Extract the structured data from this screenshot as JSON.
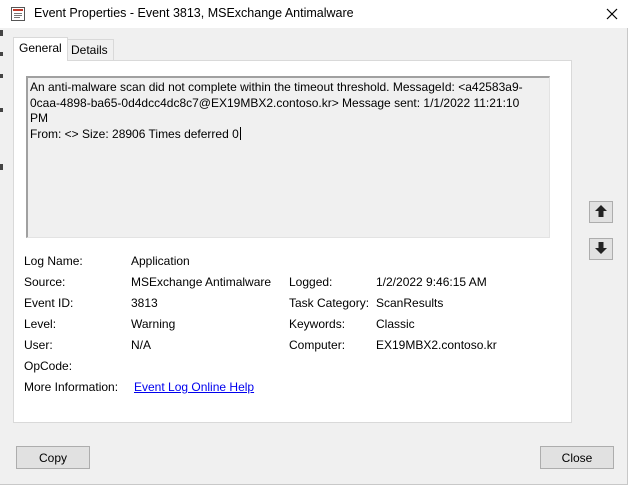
{
  "window": {
    "title": "Event Properties - Event 3813, MSExchange Antimalware"
  },
  "tabs": [
    {
      "label": "General",
      "active": true
    },
    {
      "label": "Details",
      "active": false
    }
  ],
  "message": "An anti-malware scan did not complete within the timeout threshold. MessageId: <a42583a9-\n0caa-4898-ba65-0d4dcc4dc8c7@EX19MBX2.contoso.kr> Message sent: 1/1/2022 11:21:10 PM\nFrom: <> Size: 28906 Times deferred 0",
  "fields": {
    "log_name": {
      "label": "Log Name:",
      "value": "Application"
    },
    "source": {
      "label": "Source:",
      "value": "MSExchange Antimalware"
    },
    "logged": {
      "label": "Logged:",
      "value": "1/2/2022 9:46:15 AM"
    },
    "event_id": {
      "label": "Event ID:",
      "value": "3813"
    },
    "task": {
      "label": "Task Category:",
      "value": "ScanResults"
    },
    "level": {
      "label": "Level:",
      "value": "Warning"
    },
    "keywords": {
      "label": "Keywords:",
      "value": "Classic"
    },
    "user": {
      "label": "User:",
      "value": "N/A"
    },
    "computer": {
      "label": "Computer:",
      "value": "EX19MBX2.contoso.kr"
    },
    "opcode": {
      "label": "OpCode:",
      "value": ""
    },
    "more_info": {
      "label": "More Information:",
      "value": "Event Log Online Help"
    }
  },
  "buttons": {
    "copy": "Copy",
    "close": "Close"
  },
  "icons": {
    "app": "event-properties-icon",
    "close": "close-icon",
    "up": "arrow-up-icon",
    "down": "arrow-down-icon"
  },
  "colors": {
    "link": "#0000ee",
    "panel": "#ffffff",
    "window": "#f0f0f0"
  }
}
